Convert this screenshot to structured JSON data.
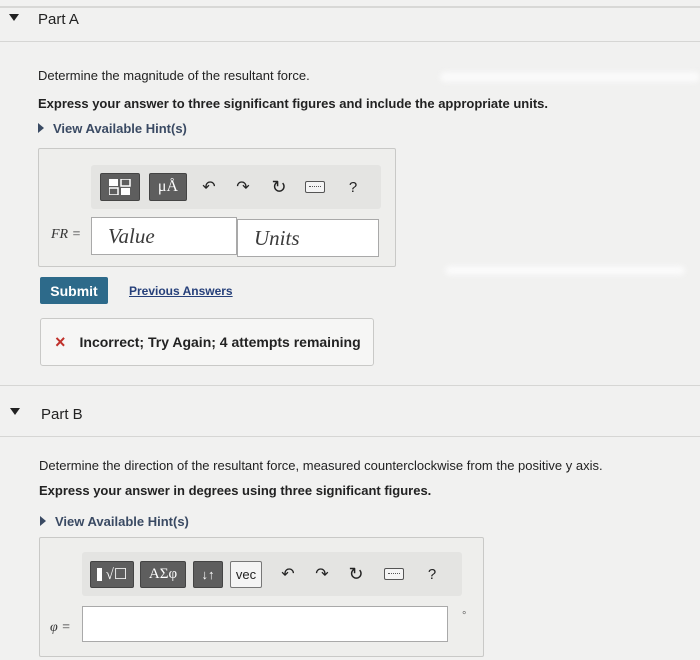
{
  "part_a": {
    "title": "Part A",
    "question": "Determine the magnitude of the resultant force.",
    "instruction": "Express your answer to three significant figures and include the appropriate units.",
    "hint_link": "View Available Hint(s)",
    "toolbar": {
      "templates_icon": "templates-icon",
      "mu_a_label": "μÅ",
      "undo_icon": "undo-icon",
      "redo_icon": "redo-icon",
      "reset_icon": "reset-icon",
      "keyboard_icon": "keyboard-icon",
      "help_label": "?"
    },
    "answer_label": "FR =",
    "value_placeholder": "Value",
    "units_placeholder": "Units",
    "submit_label": "Submit",
    "previous_answers_label": "Previous Answers",
    "feedback_icon": "×",
    "feedback_text": "Incorrect; Try Again; 4 attempts remaining"
  },
  "part_b": {
    "title": "Part B",
    "question": "Determine the direction of the resultant force, measured counterclockwise from the positive y axis.",
    "instruction": "Express your answer in degrees using three significant figures.",
    "hint_link": "View Available Hint(s)",
    "toolbar": {
      "sqrt_label": "√☐",
      "greek_label": "ΑΣφ",
      "sort_label": "↓↑",
      "vec_label": "vec",
      "undo_icon": "undo-icon",
      "redo_icon": "redo-icon",
      "reset_icon": "reset-icon",
      "keyboard_icon": "keyboard-icon",
      "help_label": "?"
    },
    "answer_label": "φ =",
    "unit_symbol": "°"
  }
}
